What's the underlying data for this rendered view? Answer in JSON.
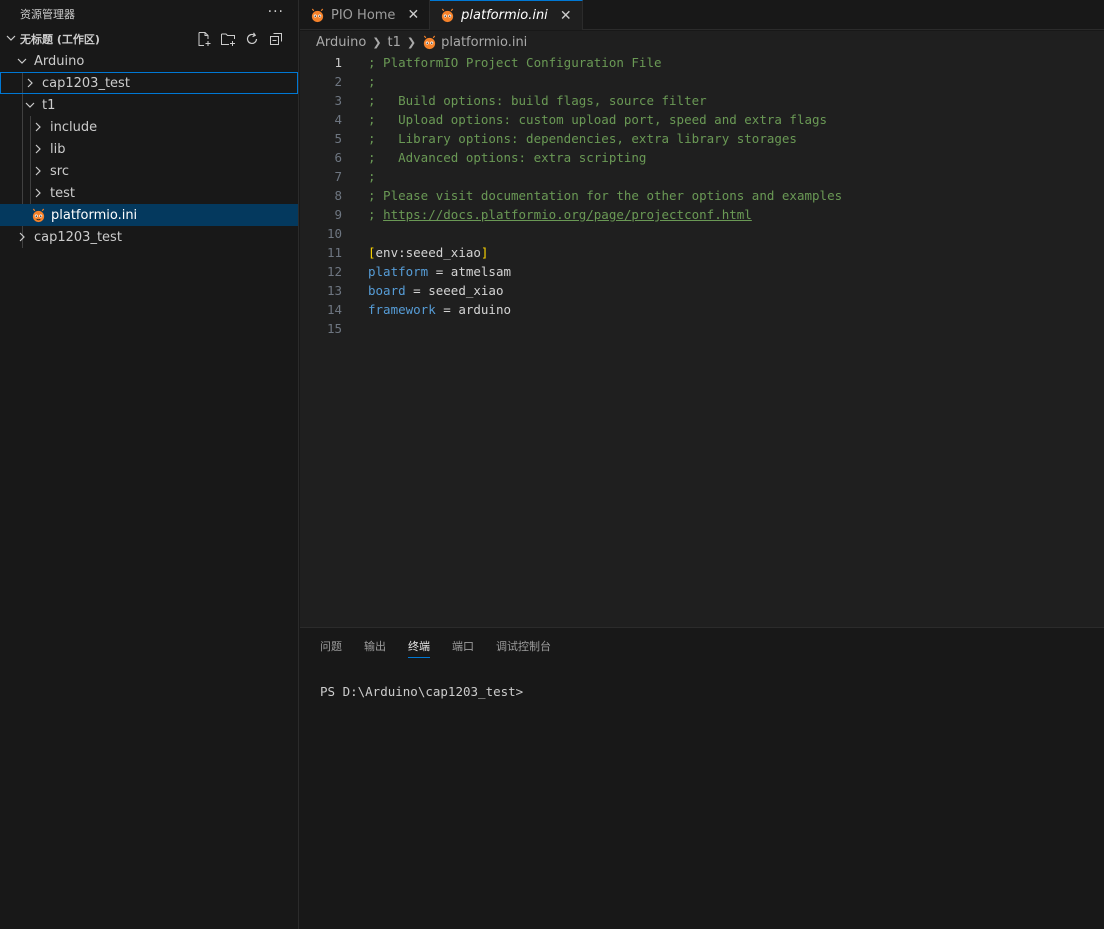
{
  "explorer": {
    "title": "资源管理器",
    "more": "···",
    "workspace_label": "无标题 (工作区)",
    "tree": [
      {
        "label": "Arduino",
        "expanded": true,
        "depth": 0,
        "type": "folder"
      },
      {
        "label": "cap1203_test",
        "expanded": false,
        "depth": 1,
        "type": "folder",
        "focused": true
      },
      {
        "label": "t1",
        "expanded": true,
        "depth": 1,
        "type": "folder"
      },
      {
        "label": "include",
        "expanded": false,
        "depth": 2,
        "type": "folder"
      },
      {
        "label": "lib",
        "expanded": false,
        "depth": 2,
        "type": "folder"
      },
      {
        "label": "src",
        "expanded": false,
        "depth": 2,
        "type": "folder"
      },
      {
        "label": "test",
        "expanded": false,
        "depth": 2,
        "type": "folder"
      },
      {
        "label": "platformio.ini",
        "depth": 2,
        "type": "file",
        "selected": true
      },
      {
        "label": "cap1203_test",
        "expanded": false,
        "depth": 0,
        "type": "folder"
      }
    ]
  },
  "tabs": [
    {
      "label": "PIO Home",
      "active": false
    },
    {
      "label": "platformio.ini",
      "active": true
    }
  ],
  "breadcrumb": [
    "Arduino",
    "t1",
    "platformio.ini"
  ],
  "editor": {
    "current_line": 1,
    "lines": [
      {
        "n": "1",
        "text": "; PlatformIO Project Configuration File"
      },
      {
        "n": "2",
        "text": ";"
      },
      {
        "n": "3",
        "text": ";   Build options: build flags, source filter"
      },
      {
        "n": "4",
        "text": ";   Upload options: custom upload port, speed and extra flags"
      },
      {
        "n": "5",
        "text": ";   Library options: dependencies, extra library storages"
      },
      {
        "n": "6",
        "text": ";   Advanced options: extra scripting"
      },
      {
        "n": "7",
        "text": ";"
      },
      {
        "n": "8",
        "text": "; Please visit documentation for the other options and examples"
      },
      {
        "n": "9",
        "prefix": "; ",
        "link": "https://docs.platformio.org/page/projectconf.html"
      },
      {
        "n": "10",
        "text": ""
      },
      {
        "n": "11",
        "section": "env:seeed_xiao"
      },
      {
        "n": "12",
        "key": "platform",
        "value": "atmelsam"
      },
      {
        "n": "13",
        "key": "board",
        "value": "seeed_xiao"
      },
      {
        "n": "14",
        "key": "framework",
        "value": "arduino"
      },
      {
        "n": "15",
        "text": ""
      }
    ]
  },
  "panel": {
    "tabs": [
      "问题",
      "输出",
      "终端",
      "端口",
      "调试控制台"
    ],
    "active_tab": "终端",
    "terminal_prompt": "PS D:\\Arduino\\cap1203_test>"
  },
  "icons": {
    "pio": "platformio-alien-icon",
    "new_file": "new-file-icon",
    "new_folder": "new-folder-icon",
    "refresh": "refresh-icon",
    "collapse": "collapse-all-icon"
  },
  "colors": {
    "accent": "#0078d4",
    "pio": "#f5822a",
    "comment": "#6a9955",
    "keyword": "#569cd6",
    "bracket": "#ffd700"
  }
}
